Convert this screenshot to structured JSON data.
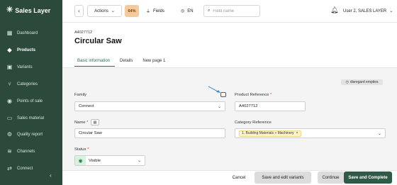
{
  "app": {
    "brand": "Sales Layer"
  },
  "sidebar": {
    "items": [
      {
        "label": "Dashboard",
        "icon": "grid-icon"
      },
      {
        "label": "Products",
        "icon": "tag-icon",
        "active": true
      },
      {
        "label": "Variants",
        "icon": "variants-icon"
      },
      {
        "label": "Categories",
        "icon": "tree-icon"
      },
      {
        "label": "Points of sale",
        "icon": "location-icon"
      },
      {
        "label": "Sales material",
        "icon": "card-icon"
      },
      {
        "label": "Quality report",
        "icon": "quality-icon"
      },
      {
        "label": "Channels",
        "icon": "layers-icon"
      },
      {
        "label": "Connect",
        "icon": "connect-icon"
      }
    ]
  },
  "toolbar": {
    "actions_label": "Actions",
    "progress": "64%",
    "fields_label": "Fields",
    "language": "EN",
    "search_placeholder": "Field name",
    "user": "User 2, SALES LAYER"
  },
  "product": {
    "id": "A4027712",
    "title": "Circular Saw"
  },
  "tabs": [
    {
      "label": "Basic information",
      "active": true
    },
    {
      "label": "Details"
    },
    {
      "label": "New page 1"
    }
  ],
  "form": {
    "disregard_label": "disregard empties",
    "family_label": "Family",
    "family_value": "Connect",
    "product_ref_label": "Product Reference",
    "product_ref_value": "A4027712",
    "name_label": "Name",
    "name_value": "Circular Saw",
    "category_ref_label": "Category Reference",
    "category_chip": "1. Building Materials » Machinery",
    "status_label": "Status",
    "status_value": "Visible"
  },
  "footer": {
    "cancel": "Cancel",
    "save_edit_variants": "Save and edit variants",
    "continue": "Continue",
    "save_complete": "Save and Complete"
  },
  "colors": {
    "sidebar_bg": "#2c4a3c",
    "accent": "#2a6b55",
    "progress_bg": "#f5c99b",
    "primary_button": "#2f5a47",
    "annotation_arrow": "#3d8fd6"
  }
}
